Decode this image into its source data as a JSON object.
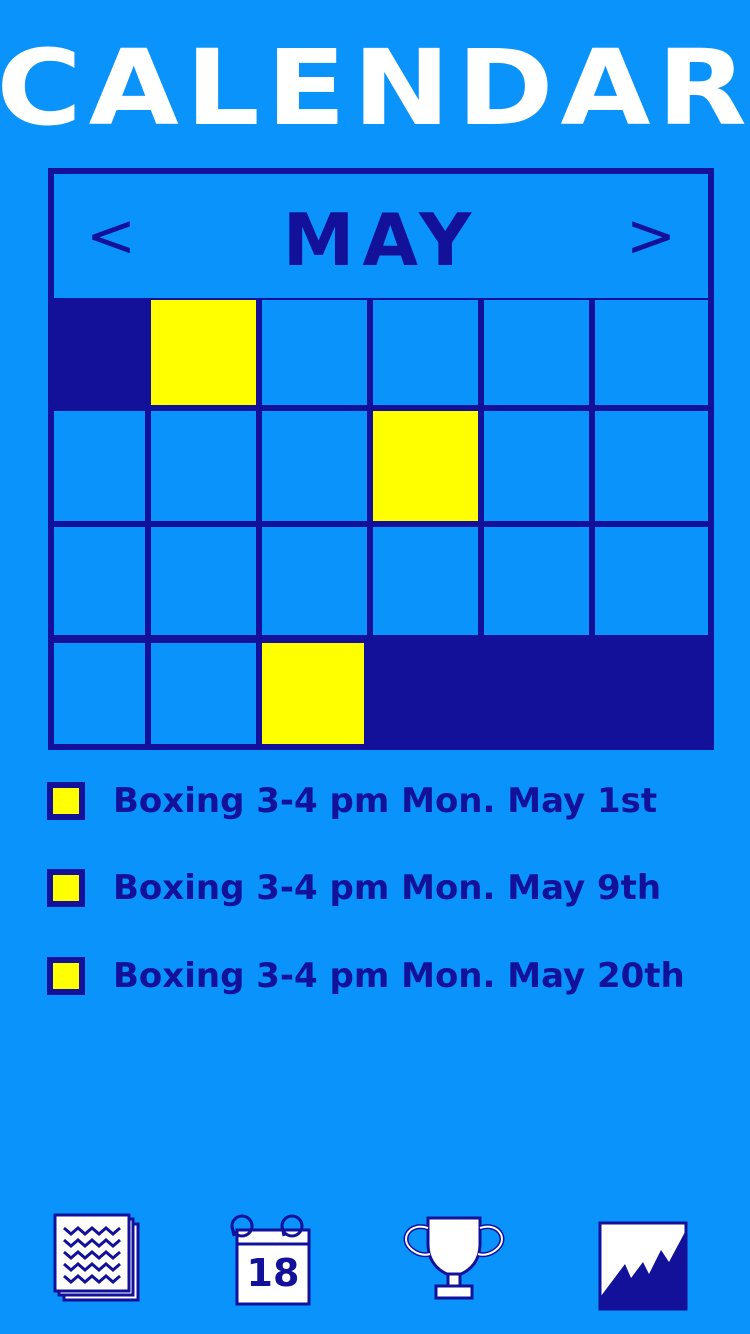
{
  "header": {
    "title": "CALENDAR"
  },
  "calendar": {
    "month": "MAY",
    "prev_label": "<",
    "next_label": ">",
    "highlight_color": "#ffff00",
    "grid_color": "#13109a"
  },
  "events": [
    {
      "label": "Boxing 3-4 pm Mon. May 1st"
    },
    {
      "label": "Boxing 3-4 pm Mon. May 9th"
    },
    {
      "label": "Boxing 3-4 pm Mon. May 20th"
    }
  ],
  "tabbar": {
    "items": [
      {
        "icon": "notes-icon"
      },
      {
        "icon": "calendar-icon",
        "badge": "18"
      },
      {
        "icon": "trophy-icon"
      },
      {
        "icon": "chart-icon"
      }
    ]
  }
}
